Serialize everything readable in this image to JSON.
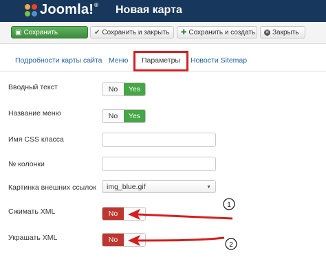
{
  "header": {
    "logo_text": "Joomla!",
    "title": "Новая карта"
  },
  "toolbar": {
    "save_label": "Сохранить",
    "save_close_label": "Сохранить и закрыть",
    "save_new_label": "Сохранить и создать",
    "close_label": "Закрыть"
  },
  "tabs": [
    {
      "label": "Подробности карты сайта"
    },
    {
      "label": "Меню"
    },
    {
      "label": "Параметры",
      "active": true
    },
    {
      "label": "Новости Sitemap"
    }
  ],
  "form": {
    "intro_text": {
      "label": "Вводный текст",
      "no": "No",
      "yes": "Yes",
      "value": "Yes"
    },
    "menu_name": {
      "label": "Название меню",
      "no": "No",
      "yes": "Yes",
      "value": "Yes"
    },
    "css_class": {
      "label": "Имя CSS класса",
      "value": ""
    },
    "columns": {
      "label": "№ колонки",
      "value": ""
    },
    "ext_link_image": {
      "label": "Картинка внешних ссылок",
      "value": "img_blue.gif"
    },
    "compress_xml": {
      "label": "Сжимать XML",
      "no": "No",
      "value": "No"
    },
    "beautify_xml": {
      "label": "Украшать XML",
      "no": "No",
      "value": "No"
    }
  },
  "annotations": {
    "marker_1": "1",
    "marker_2": "2",
    "color": "#d31f1f"
  },
  "colors": {
    "header_bg": "#17385c",
    "save_green": "#46a546",
    "toggle_no_red": "#bd362f",
    "link_blue": "#1f5f9e"
  }
}
